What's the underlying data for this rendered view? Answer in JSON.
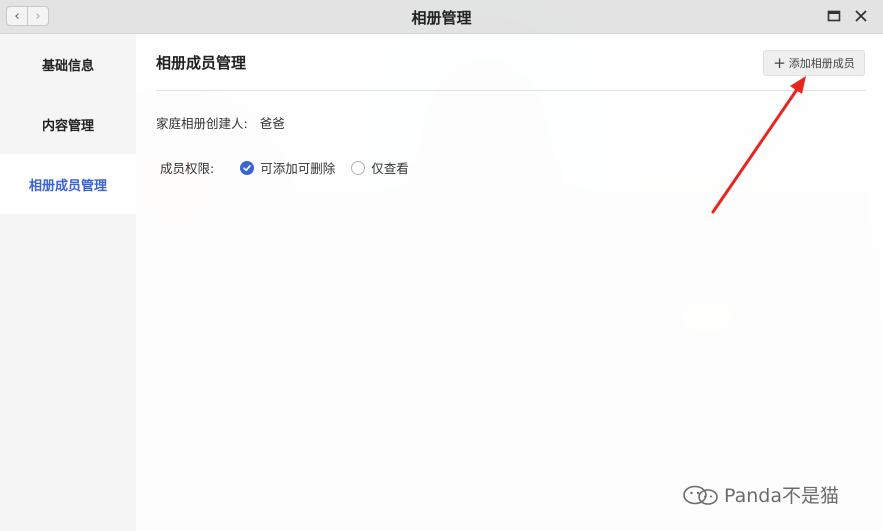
{
  "window": {
    "title": "相册管理"
  },
  "sidebar": {
    "items": [
      {
        "label": "基础信息"
      },
      {
        "label": "内容管理"
      },
      {
        "label": "相册成员管理"
      }
    ]
  },
  "main": {
    "title": "相册成员管理",
    "add_button_label": "添加相册成员",
    "creator_label": "家庭相册创建人:",
    "creator_name": "爸爸",
    "permission_label": "成员权限:",
    "permission_options": [
      {
        "label": "可添加可删除",
        "selected": true
      },
      {
        "label": "仅查看",
        "selected": false
      }
    ]
  },
  "watermark": {
    "text": "Panda不是猫"
  },
  "colors": {
    "accent": "#3b63d6",
    "annotation": "#e8261f"
  }
}
